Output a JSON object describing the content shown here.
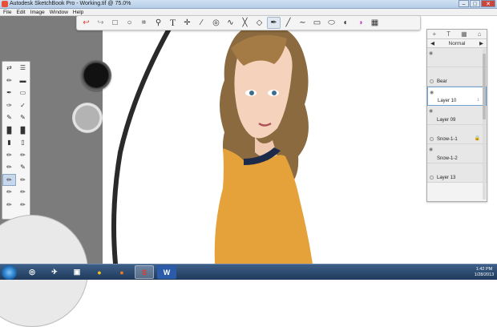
{
  "window": {
    "title": "Autodesk SketchBook Pro - Working.tif @ 75.0%",
    "controls": [
      "–",
      "□",
      "✕"
    ]
  },
  "menu": [
    "File",
    "Edit",
    "Image",
    "Window",
    "Help"
  ],
  "toolbar": {
    "icons": [
      "undo-icon",
      "redo-icon",
      "rectangle-select-icon",
      "lasso-select-icon",
      "crop-icon",
      "zoom-icon",
      "text-icon",
      "move-icon",
      "ruler-icon",
      "ellipse-icon",
      "french-curve-icon",
      "symmetry-icon",
      "distort-icon",
      "pen-icon",
      "line-icon",
      "curve-icon",
      "rectangle-icon",
      "ellipse-shape-icon",
      "brush-palette-icon",
      "color-wheel-icon",
      "layers-icon"
    ],
    "glyphs": [
      "↩",
      "↪",
      "□",
      "○",
      "⌗",
      "⚲",
      "T",
      "✛",
      "∕",
      "◎",
      "∿",
      "╳",
      "◇",
      "✒",
      "╱",
      "∼",
      "▭",
      "⬭",
      "◐",
      "◑",
      "▦"
    ]
  },
  "layer_editor": {
    "header_icons": [
      "+",
      "T",
      "▦",
      "⌂"
    ],
    "blend_mode": "Normal",
    "blend_left": "◀",
    "blend_right": "▶",
    "layers": [
      {
        "name": ""
      },
      {
        "name": "Bear"
      },
      {
        "name": "Layer 10",
        "selected": true
      },
      {
        "name": "Layer 09"
      },
      {
        "name": "Snow-1-1",
        "locked": true
      },
      {
        "name": "Snow-1-2"
      },
      {
        "name": "Layer 13"
      }
    ]
  },
  "taskbar": {
    "apps": [
      "◎",
      "✈",
      "▣",
      "●",
      "●",
      "S",
      "W"
    ],
    "time": "1:42 PM",
    "date": "1/28/2013"
  },
  "colors": {
    "accent": "#6fa3d8",
    "taskbar": "#1f3a5c"
  }
}
